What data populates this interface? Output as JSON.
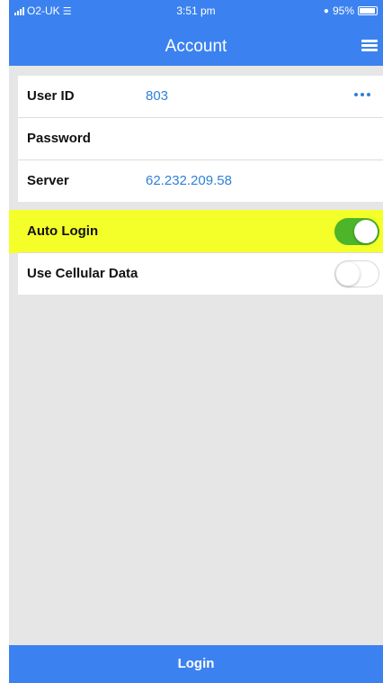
{
  "status_bar": {
    "carrier": "O2-UK",
    "time": "3:51 pm",
    "battery": "95%"
  },
  "header": {
    "title": "Account",
    "menu_icon": "hamburger-menu-icon"
  },
  "account": {
    "user_id_label": "User ID",
    "user_id_value": "803",
    "password_label": "Password",
    "server_label": "Server",
    "server_value": "62.232.209.58"
  },
  "options": {
    "auto_login_label": "Auto Login",
    "auto_login_on": true,
    "cellular_label": "Use Cellular Data",
    "cellular_on": false
  },
  "footer": {
    "login_label": "Login"
  },
  "colors": {
    "accent": "#3b82f0",
    "value_text": "#2f7fd8",
    "toggle_on": "#4cb52a",
    "highlight": "#f4ff2a"
  }
}
